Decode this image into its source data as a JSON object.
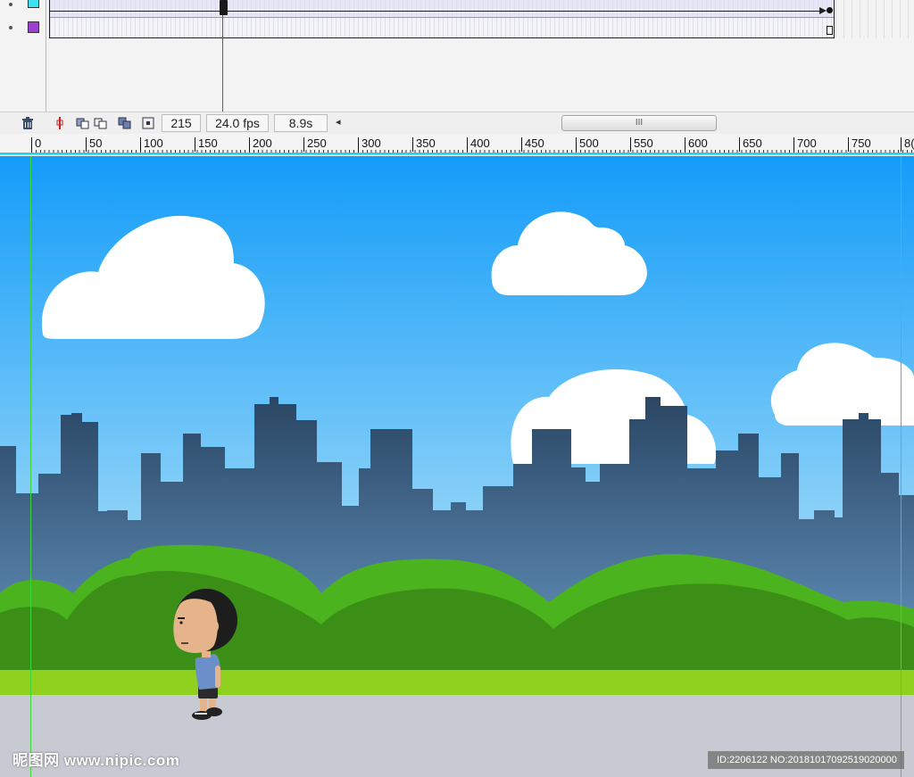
{
  "timeline": {
    "layers": [
      {
        "name": "cyan-layer",
        "color": "#3fe0f0"
      },
      {
        "name": "purple-layer",
        "color": "#9b3fcf"
      }
    ],
    "current_frame": "215",
    "fps": "24.0 fps",
    "elapsed": "8.9s",
    "scroll_thumb": "III"
  },
  "ruler": {
    "labels": [
      "0",
      "50",
      "100",
      "150",
      "200",
      "250",
      "300",
      "350",
      "400",
      "450",
      "500",
      "550",
      "600",
      "650",
      "700",
      "750",
      "8("
    ]
  },
  "stage": {
    "sky_top": "#139cf9",
    "sky_bottom": "#8fd3f7",
    "skyline": "#2f4f6f",
    "bush_light": "#4ab31d",
    "bush_dark": "#3b8f16",
    "grass": "#8fd11e",
    "road": "#c8cad3",
    "guide": "#3ad63a"
  },
  "watermark": {
    "left": "昵图网 www.nipic.com",
    "right": "ID:2206122 NO:20181017092519020000"
  }
}
